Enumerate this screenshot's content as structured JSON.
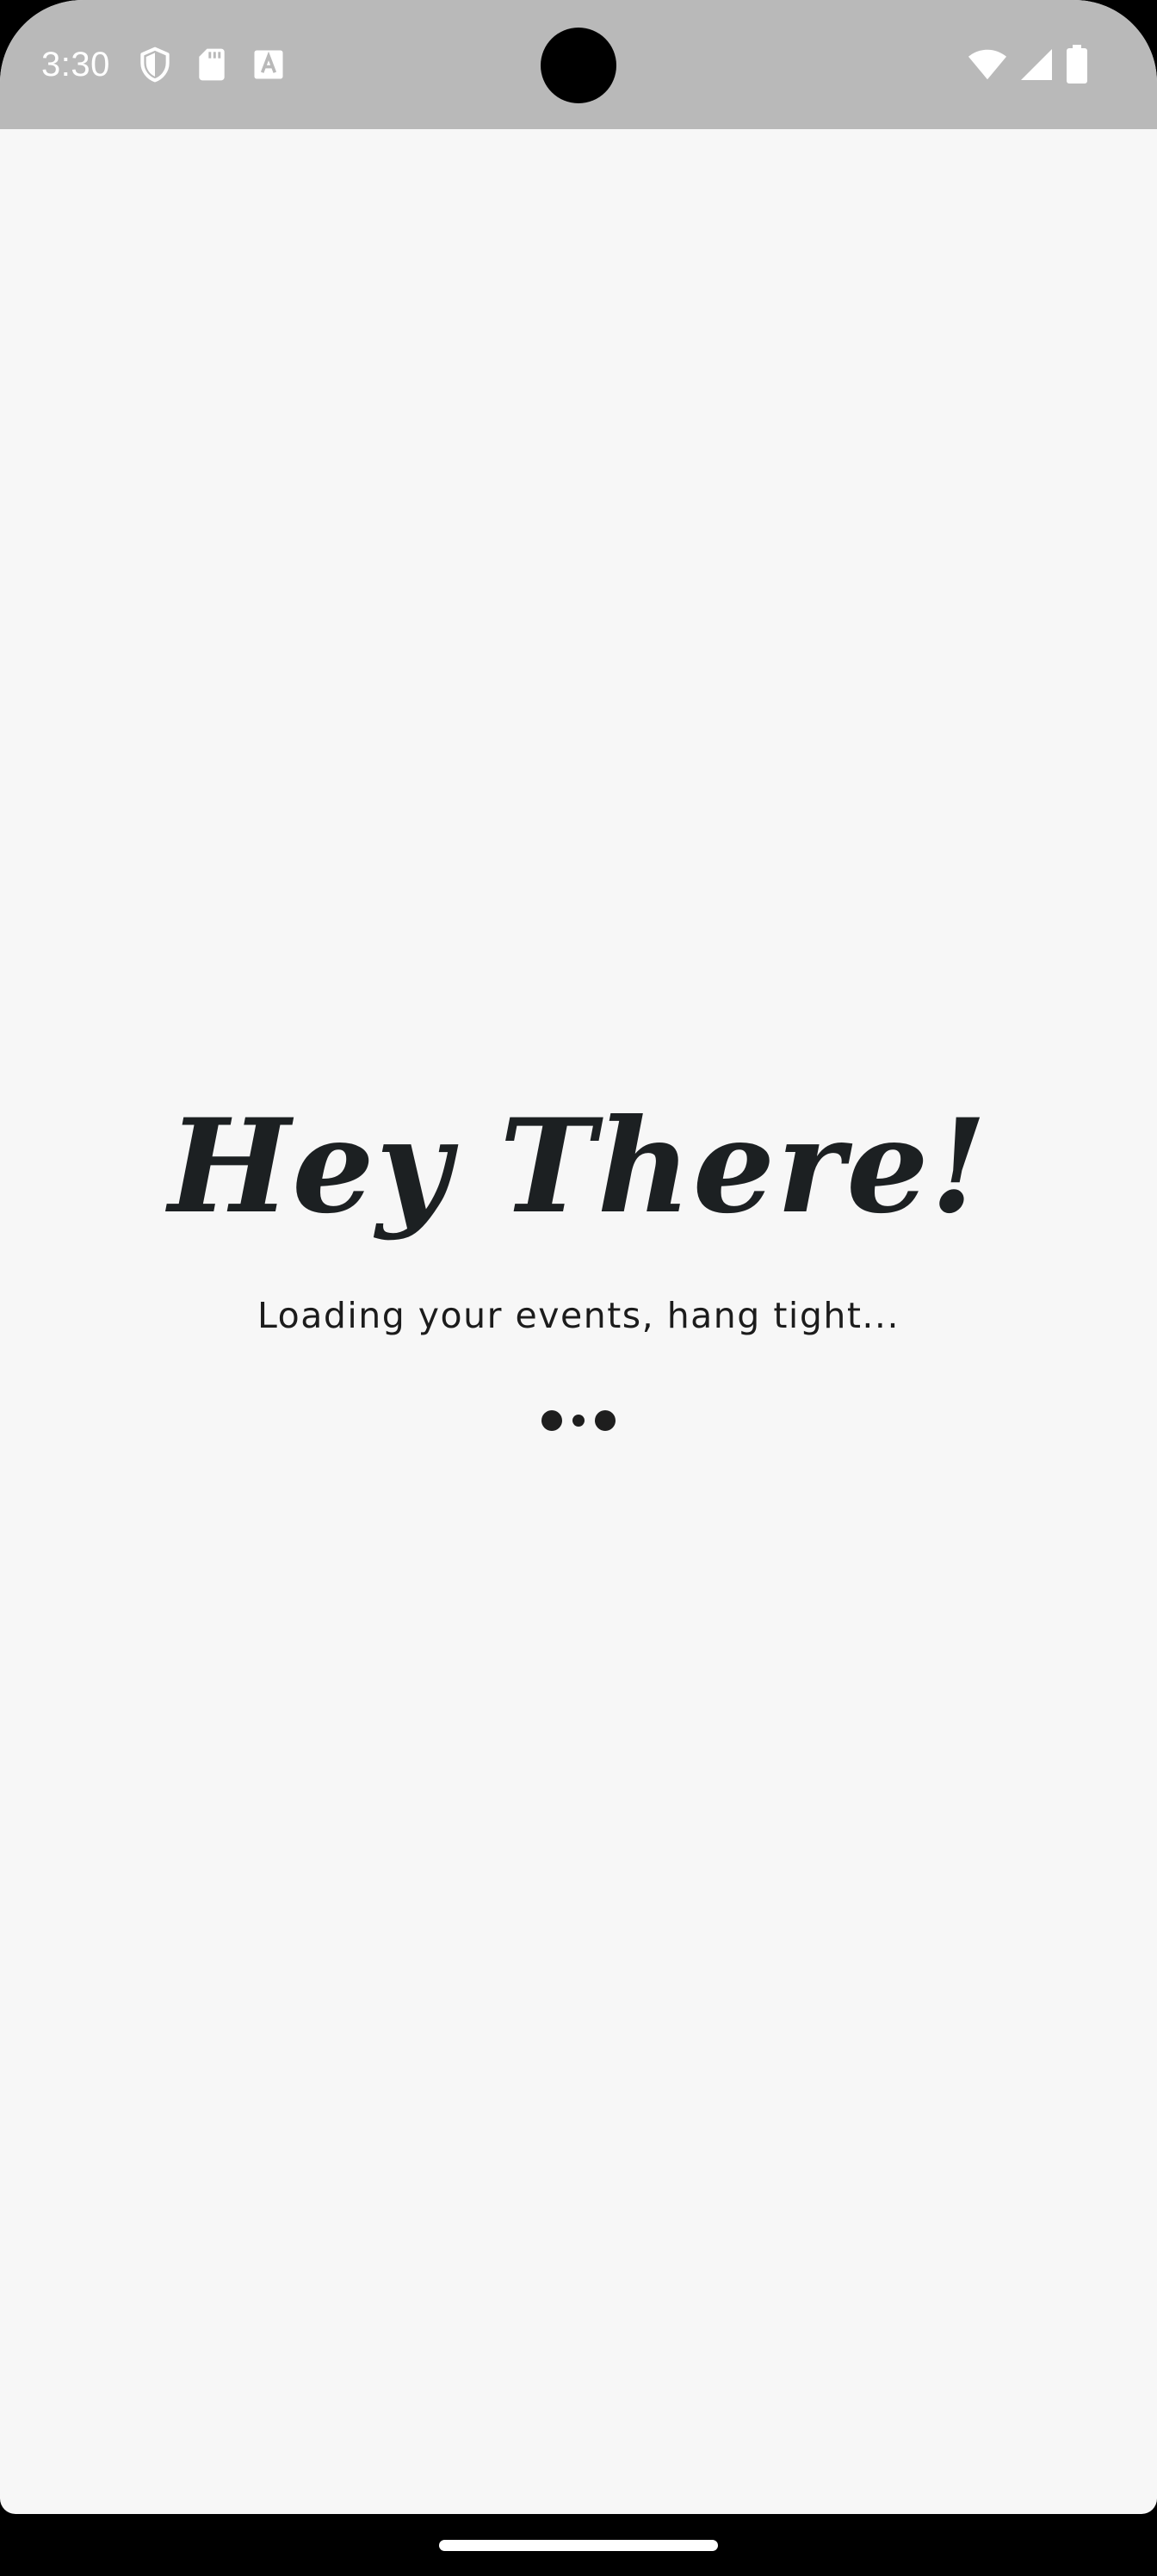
{
  "status_bar": {
    "time": "3:30",
    "background": "#b9b9b9",
    "left_icons": [
      "shield-icon",
      "sd-card-icon",
      "text-a-icon"
    ],
    "right_icons": [
      "wifi-icon",
      "signal-icon",
      "battery-icon"
    ]
  },
  "main": {
    "greeting": "Hey There!",
    "subtitle": "Loading your events, hang tight...",
    "loader_icon": "loading-dots-icon"
  },
  "colors": {
    "screen_background": "#f7f7f7",
    "text": "#1c2022",
    "nav_bar": "#000000"
  }
}
